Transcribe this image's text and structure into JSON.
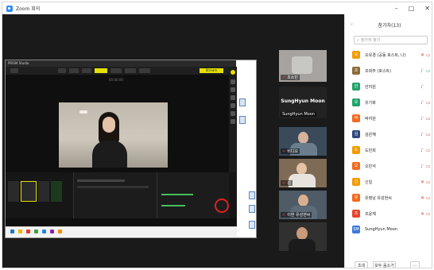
{
  "window": {
    "title": "Zoom 회의",
    "controls": [
      "–",
      "□",
      "✕"
    ]
  },
  "share": {
    "app_title": "PRISM Studio",
    "top_right_button": "Stream",
    "timer": "00:00:00"
  },
  "gallery": [
    {
      "name": "조소민",
      "kind": "tiny-video",
      "muted": true
    },
    {
      "name": "SungHyun Moon",
      "kind": "name-only",
      "muted": false
    },
    {
      "name": "SungHyun Moon",
      "kind": "video",
      "muted": false
    },
    {
      "name": "비디오",
      "kind": "video",
      "muted": true
    },
    {
      "name": "김",
      "kind": "video",
      "muted": true
    },
    {
      "name": "이현 유성현씨",
      "kind": "video",
      "muted": true
    },
    {
      "name": "",
      "kind": "video",
      "muted": false
    }
  ],
  "participants": {
    "title": "참가자(13)",
    "search_placeholder": "참가자 찾기",
    "list": [
      {
        "initial": "오",
        "name": "오유경 (공동 호스트, 나)",
        "color": "#f29b00",
        "mic": "muted",
        "cam": "off"
      },
      {
        "initial": "조",
        "name": "조희주 (호스트)",
        "color": "#8a6d3b",
        "mic": "on",
        "cam": "on"
      },
      {
        "initial": "안",
        "name": "안지원",
        "color": "#22a36b",
        "mic": "on",
        "cam": "none"
      },
      {
        "initial": "유",
        "name": "유기화",
        "color": "#22a36b",
        "mic": "on",
        "cam": "off"
      },
      {
        "initial": "박",
        "name": "박지원",
        "color": "#f26b21",
        "mic": "on",
        "cam": "off"
      },
      {
        "initial": "김",
        "name": "김은혜",
        "color": "#2f4a7a",
        "mic": "on",
        "cam": "off"
      },
      {
        "initial": "도",
        "name": "도민희",
        "color": "#f29b00",
        "mic": "on",
        "cam": "off"
      },
      {
        "initial": "오",
        "name": "오민석",
        "color": "#f26b21",
        "mic": "on",
        "cam": "off"
      },
      {
        "initial": "신",
        "name": "신일",
        "color": "#f29b00",
        "mic": "muted",
        "cam": "off"
      },
      {
        "initial": "유",
        "name": "유정남 유성현씨",
        "color": "#f26b21",
        "mic": "muted",
        "cam": "off"
      },
      {
        "initial": "조",
        "name": "조윤재",
        "color": "#e8452c",
        "mic": "muted",
        "cam": "off"
      },
      {
        "initial": "SM",
        "name": "SungHyun Moon",
        "color": "#3d7bd9",
        "mic": "none",
        "cam": "none"
      }
    ],
    "footer": {
      "invite": "초대",
      "mute_all": "모두 음소거",
      "more": "..."
    }
  },
  "colors": {
    "main_bg": "#1a1a1a",
    "muted_red": "#e13b3b",
    "unmuted_gray": "#888888",
    "cam_on_green": "#22a36b",
    "highlight_circle": "#dd2222"
  }
}
